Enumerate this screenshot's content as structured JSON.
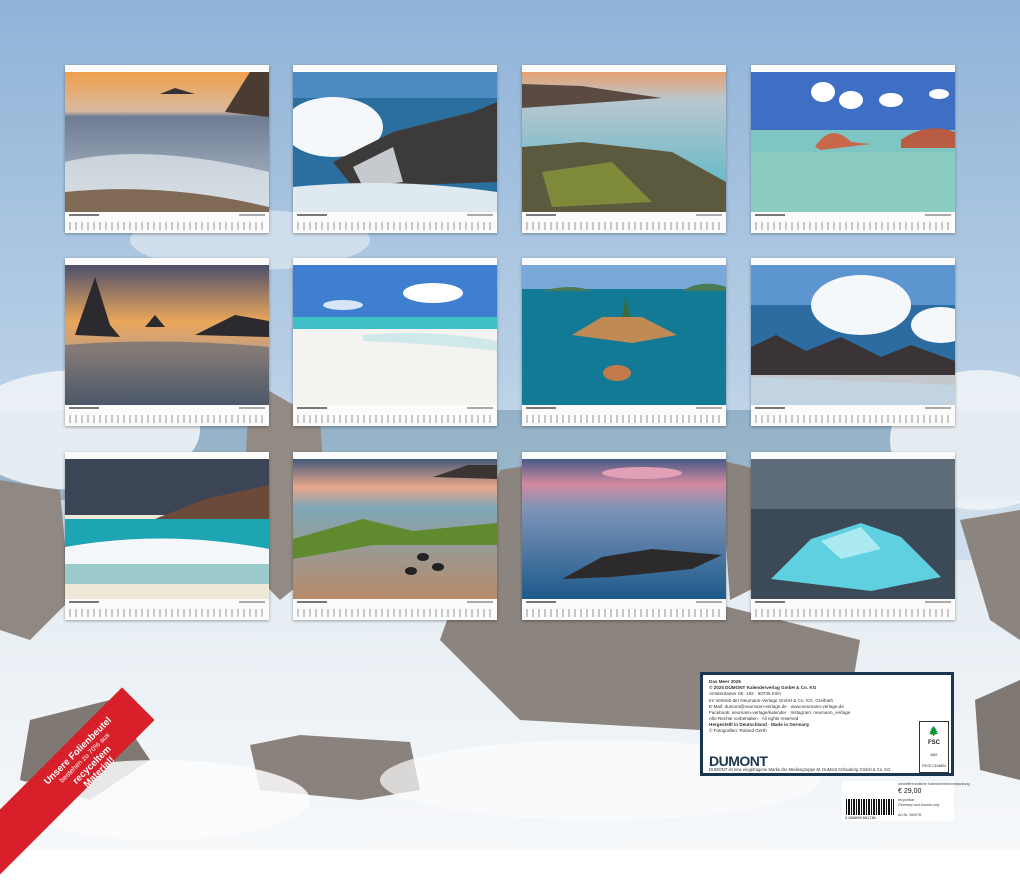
{
  "months": [
    {
      "id": "jan",
      "caption": "",
      "scene": "sunset-surf"
    },
    {
      "id": "feb",
      "caption": "",
      "scene": "crashing-wave"
    },
    {
      "id": "mar",
      "caption": "",
      "scene": "tidal-pool"
    },
    {
      "id": "apr",
      "caption": "",
      "scene": "granite-lagoon"
    },
    {
      "id": "may",
      "caption": "",
      "scene": "sea-stack-sunset"
    },
    {
      "id": "jun",
      "caption": "",
      "scene": "white-sand-beach"
    },
    {
      "id": "jul",
      "caption": "",
      "scene": "rock-islet"
    },
    {
      "id": "aug",
      "caption": "",
      "scene": "wave-spray-rocks"
    },
    {
      "id": "sep",
      "caption": "",
      "scene": "turquoise-surf"
    },
    {
      "id": "oct",
      "caption": "",
      "scene": "mossy-shore"
    },
    {
      "id": "nov",
      "caption": "",
      "scene": "pink-dusk-rocks"
    },
    {
      "id": "dec",
      "caption": "",
      "scene": "iceberg"
    }
  ],
  "publisher": {
    "title": "Das Meer 2026",
    "copyright": "© 2025 DUMONT Kalenderverlag GmbH & Co. KG",
    "address": "Amsterdamer Str. 192 · 50735 Köln",
    "distribution": "Im Vertrieb der Neumann-Verlage GmbH & Co. KG, Greifrath",
    "email": "E-Mail: dumont@neumann-verlage.de · www.neumann-verlage.de",
    "social": "Facebook: neumann-verlage/kalender · Instagram: neumann_verlage",
    "rights": "Alle Rechte vorbehalten · All rights reserved",
    "made_in": "Hergestellt in Deutschland · Made in Germany",
    "photographer": "© Fotografien: Roland Gerth",
    "logo": "DUMONT",
    "brand_note": "DUMONT ist eine eingetragene Marke der Mediengruppe M. DuMont Schauberg GmbH & Co. KG",
    "fsc_label": "FSC",
    "fsc_mix": "MIX",
    "fsc_code": "FSC® C104604"
  },
  "barcode": {
    "number": "4 065695 661781",
    "price": "€ 29,00",
    "note_1": "umweltfreundliche Kalenderfolienverpackung",
    "note_2": "recycelbar",
    "note_3": "Germany and Austria only",
    "art_no": "Art.Nr. 260078"
  },
  "sash": {
    "line_1": "Unsere Folienbeutel",
    "line_2": "bestehen zu 70% aus",
    "line_3": "recyceltem",
    "line_4": "Material!"
  },
  "colors": {
    "sky": "#a9c4e0",
    "sea": "#1f6f9a",
    "foam": "#f2f6f8",
    "rock": "#8c8580",
    "info_border": "#1b3550",
    "sash": "#d8202a"
  }
}
